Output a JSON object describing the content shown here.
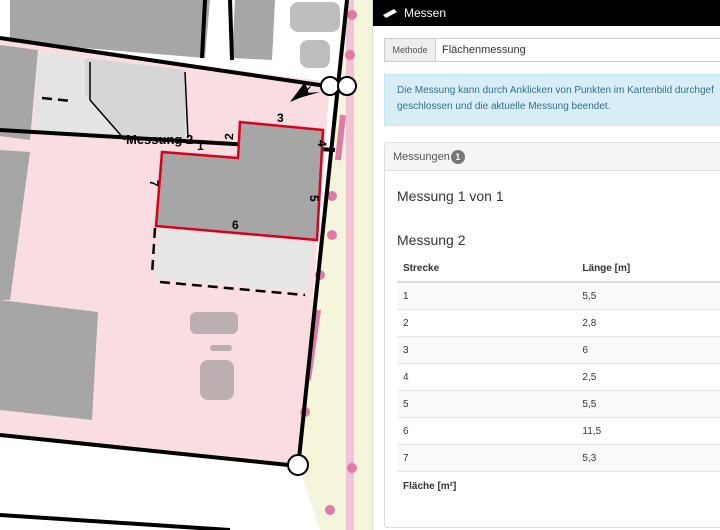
{
  "map": {
    "measurement_label": "Messung 2",
    "edge_labels": [
      "1",
      "2",
      "3",
      "4",
      "5",
      "6",
      "7"
    ],
    "colors": {
      "parcel": "#fadde1",
      "street": "#f4f5da",
      "building": "#a6a6a6",
      "outline": "#d9001b",
      "marker": "#e07aa8"
    }
  },
  "panel": {
    "title": "Messen",
    "methode_label": "Methode",
    "methode_value": "Flächenmessung",
    "info_line1": "Die Messung kann durch Anklicken von Punkten im Kartenbild durchgef",
    "info_line2": "geschlossen und die aktuelle Messung beendet.",
    "measurements_label": "Messungen",
    "measurements_count": "1",
    "counter_text": "Messung 1 von 1",
    "current_title": "Messung 2",
    "table": {
      "headers": [
        "Strecke",
        "Länge [m]"
      ],
      "rows": [
        {
          "strecke": "1",
          "laenge": "5,5"
        },
        {
          "strecke": "2",
          "laenge": "2,8"
        },
        {
          "strecke": "3",
          "laenge": "6"
        },
        {
          "strecke": "4",
          "laenge": "2,5"
        },
        {
          "strecke": "5",
          "laenge": "5,5"
        },
        {
          "strecke": "6",
          "laenge": "11,5"
        },
        {
          "strecke": "7",
          "laenge": "5,3"
        }
      ],
      "area_label": "Fläche [m²]"
    }
  }
}
